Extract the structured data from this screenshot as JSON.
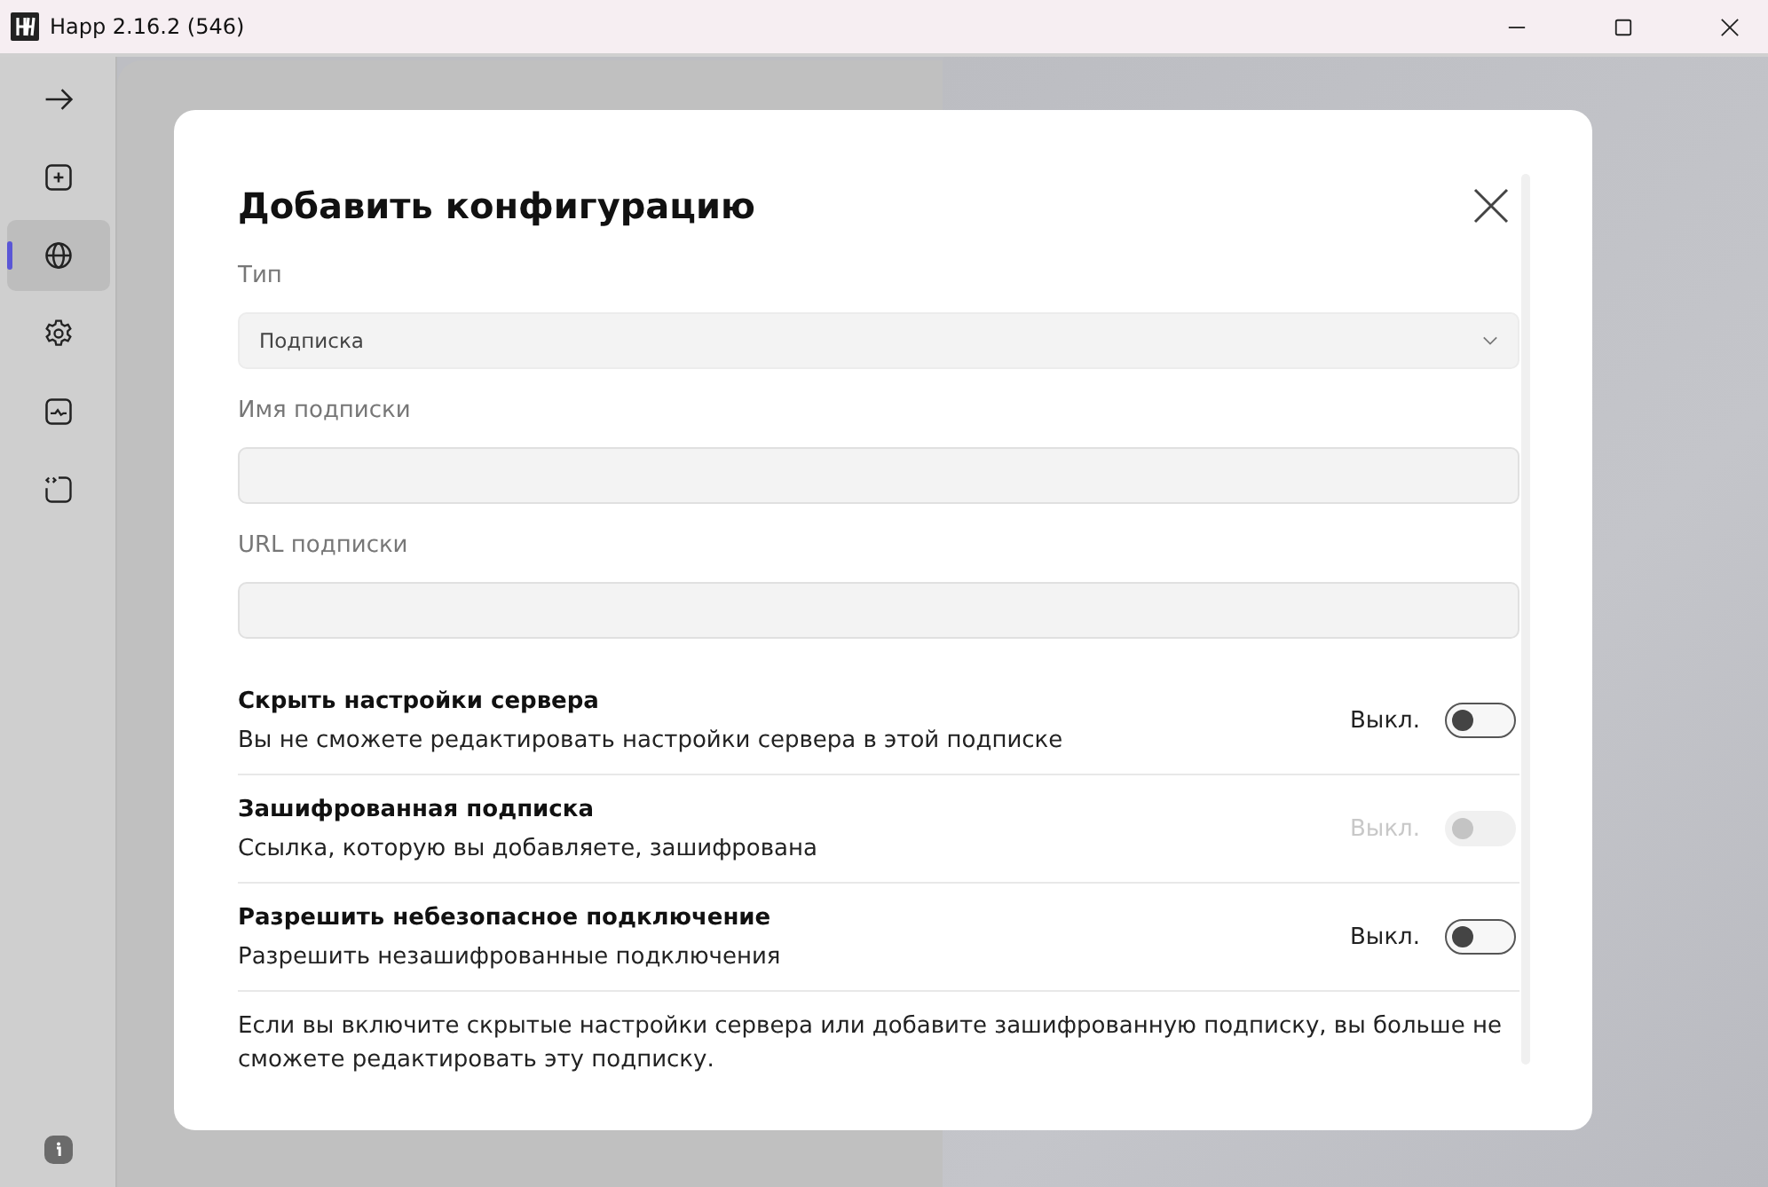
{
  "window": {
    "title": "Happ 2.16.2 (546)"
  },
  "sidebar": {
    "items": [
      {
        "kind": "arrow",
        "selected": false
      },
      {
        "kind": "plus",
        "selected": false
      },
      {
        "kind": "globe",
        "selected": true
      },
      {
        "kind": "gear",
        "selected": false
      },
      {
        "kind": "monitor",
        "selected": false
      },
      {
        "kind": "code",
        "selected": false
      }
    ]
  },
  "dialog": {
    "title": "Добавить конфигурацию",
    "fields": [
      {
        "label": "Тип",
        "kind": "select",
        "value": "Подписка"
      },
      {
        "label": "Имя подписки",
        "kind": "input"
      },
      {
        "label": "URL подписки",
        "kind": "input"
      }
    ],
    "toggles": [
      {
        "title": "Скрыть настройки сервера",
        "description": "Вы не сможете редактировать настройки сервера в этой подписке",
        "state_label": "Выкл.",
        "on": false,
        "disabled": false
      },
      {
        "title": "Зашифрованная подписка",
        "description": "Ссылка, которую вы добавляете, зашифрована",
        "state_label": "Выкл.",
        "on": false,
        "disabled": true
      },
      {
        "title": "Разрешить небезопасное подключение",
        "description": "Разрешить незашифрованные подключения",
        "state_label": "Выкл.",
        "on": false,
        "disabled": false
      }
    ],
    "note": "Если вы включите скрытые настройки сервера или добавите зашифрованную подписку, вы больше не сможете редактировать эту подписку."
  }
}
